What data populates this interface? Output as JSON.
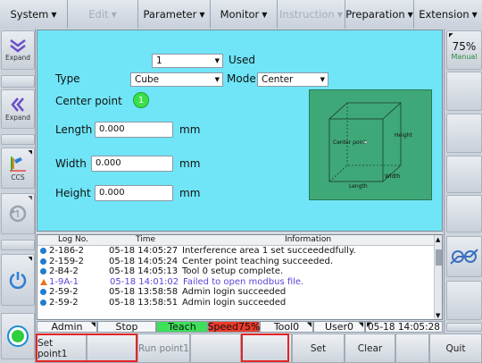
{
  "menu": [
    {
      "label": "System",
      "disabled": false
    },
    {
      "label": "Edit",
      "disabled": true
    },
    {
      "label": "Parameter",
      "disabled": false
    },
    {
      "label": "Monitor",
      "disabled": false
    },
    {
      "label": "Instruction",
      "disabled": true
    },
    {
      "label": "Preparation",
      "disabled": false
    },
    {
      "label": "Extension",
      "disabled": false
    }
  ],
  "left_toolbar": {
    "expand1": "Expand",
    "expand2": "Expand",
    "ccs": "CCS"
  },
  "right_toolbar": {
    "speed_percent": "75%",
    "speed_mode": "Manual"
  },
  "form": {
    "index_value": "1",
    "used_label": "Used",
    "type_label": "Type",
    "type_value": "Cube",
    "mode_label": "Mode",
    "mode_value": "Center",
    "center_point_label": "Center point",
    "center_point_number": "1",
    "length_label": "Length",
    "length_value": "0.000",
    "width_label": "Width",
    "width_value": "0.000",
    "height_label": "Height",
    "height_value": "0.000",
    "unit": "mm",
    "diagram": {
      "center_label": "Center point",
      "height_label": "Height",
      "width_label": "Width",
      "length_label": "Length"
    }
  },
  "log": {
    "headers": {
      "log_no": "Log No.",
      "time": "Time",
      "info": "Information"
    },
    "rows": [
      {
        "type": "info",
        "log_no": "2-186-2",
        "time": "05-18 14:05:27",
        "info": "Interference area 1 set succeededfully."
      },
      {
        "type": "info",
        "log_no": "2-159-2",
        "time": "05-18 14:05:24",
        "info": "Center point teaching succeeded."
      },
      {
        "type": "info",
        "log_no": "2-B4-2",
        "time": "05-18 14:05:13",
        "info": "Tool 0 setup complete."
      },
      {
        "type": "warn",
        "log_no": "1-9A-1",
        "time": "05-18 14:01:02",
        "info": "Failed to open modbus file."
      },
      {
        "type": "info",
        "log_no": "2-59-2",
        "time": "05-18 13:58:58",
        "info": "Admin  login succeeded"
      },
      {
        "type": "info",
        "log_no": "2-59-2",
        "time": "05-18 13:58:51",
        "info": "Admin  login succeeded"
      }
    ]
  },
  "status": {
    "user": "Admin",
    "run_state": "Stop",
    "mode": "Teach",
    "speed": "Speed75%",
    "tool": "Tool0",
    "user_frame": "User0",
    "datetime": "05-18 14:05:28"
  },
  "bottom_buttons": {
    "set_point1": "Set point1",
    "run_point1": "Run point1",
    "set": "Set",
    "clear": "Clear",
    "quit": "Quit"
  },
  "colors": {
    "panel_bg": "#6fe5f7",
    "teach_green": "#3ee05a",
    "speed_red": "#ee3a2a",
    "highlight_red": "#e42424",
    "diagram_green": "#3fa878",
    "warning_text": "#5a45d8"
  }
}
